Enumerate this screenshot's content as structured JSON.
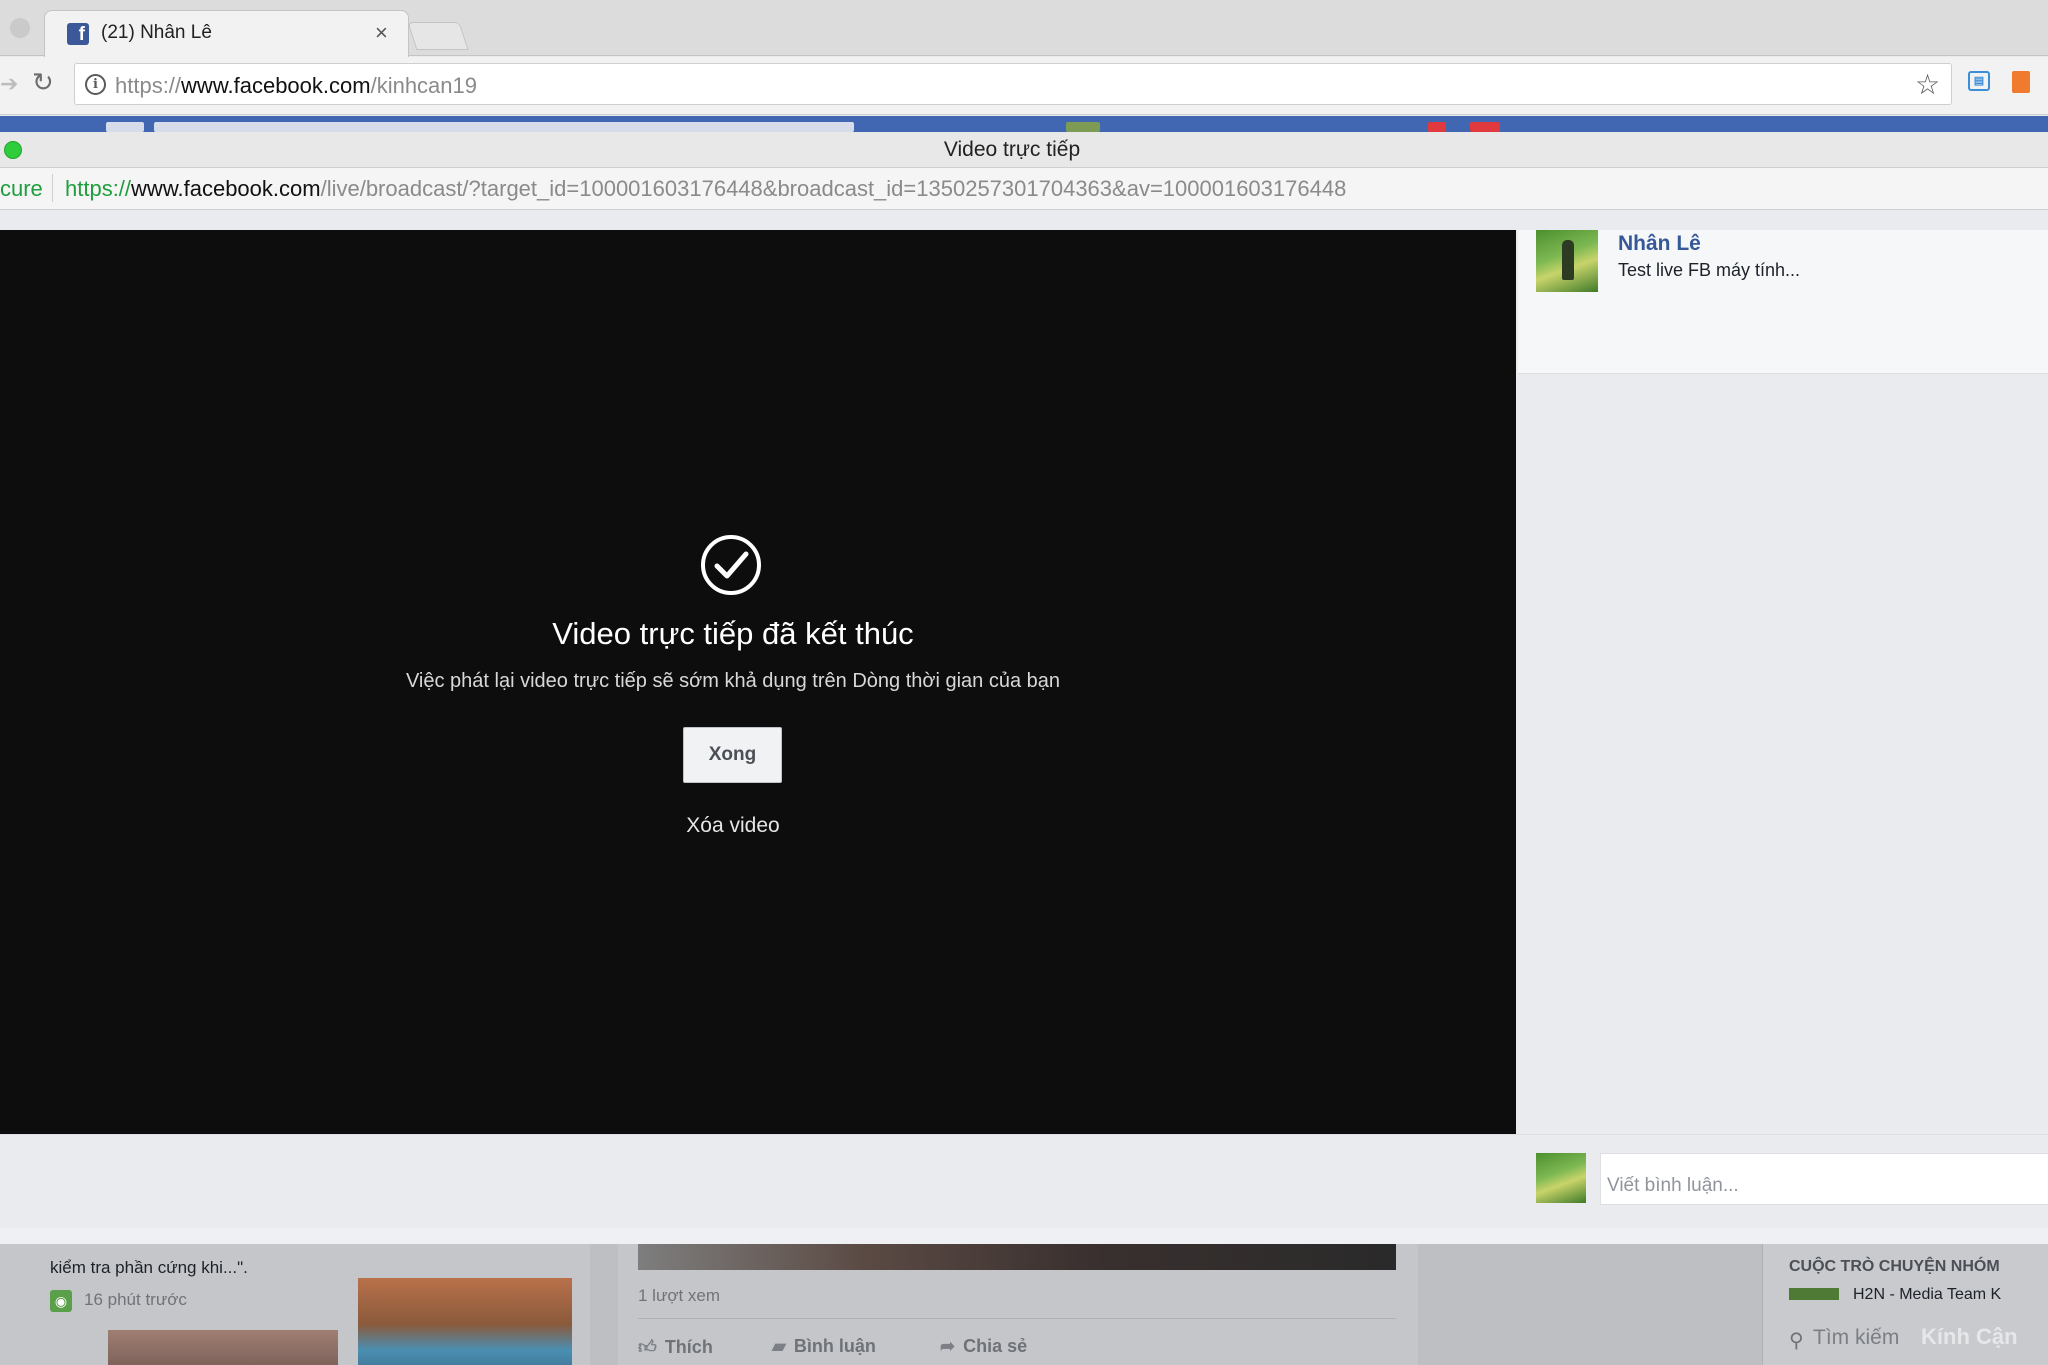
{
  "browser": {
    "tab_title": "(21) Nhân Lê",
    "tab_favicon": "f",
    "tab_close": "×",
    "url_scheme": "https://",
    "url_host": "www.facebook.com",
    "url_path": "/kinhcan19"
  },
  "popup": {
    "window_title": "Video trực tiếp",
    "secure_label": "cure",
    "url_scheme": "https://",
    "url_host": "www.facebook.com",
    "url_path": "/live/broadcast/?target_id=100001603176448&broadcast_id=1350257301704363&av=100001603176448"
  },
  "video": {
    "status_title": "Video trực tiếp đã kết thúc",
    "status_description": "Việc phát lại video trực tiếp sẽ sớm khả dụng trên Dòng thời gian của bạn",
    "done_label": "Xong",
    "delete_label": "Xóa video"
  },
  "sidebar": {
    "author_name": "Nhân Lê",
    "status_text": "Test live FB máy tính..."
  },
  "comment": {
    "placeholder": "Viết bình luận..."
  },
  "background_page": {
    "snippet": "kiểm tra phần cứng khi...\".",
    "time_ago": "16 phút trước",
    "views": "1 lượt xem",
    "like_label": "Thích",
    "comment_label": "Bình luận",
    "share_label": "Chia sẻ",
    "group_header": "CUỘC TRÒ CHUYỆN NHÓM",
    "group_name": "H2N - Media Team K",
    "search_label": "Tìm kiếm",
    "watermark": "Kính Cận"
  },
  "icons": {
    "reload": "reload-icon",
    "info": "info-icon",
    "star": "star-icon",
    "check": "check-circle-icon",
    "rss": "rss-icon",
    "like": "thumbs-up-icon",
    "comment": "comment-icon",
    "share": "share-icon",
    "search": "search-icon"
  },
  "colors": {
    "facebook_blue": "#4267b2",
    "link_blue": "#365899",
    "secure_green": "#1e9e3e",
    "video_background": "#0d0d0e",
    "window_dot_green": "#2fcc3b"
  }
}
